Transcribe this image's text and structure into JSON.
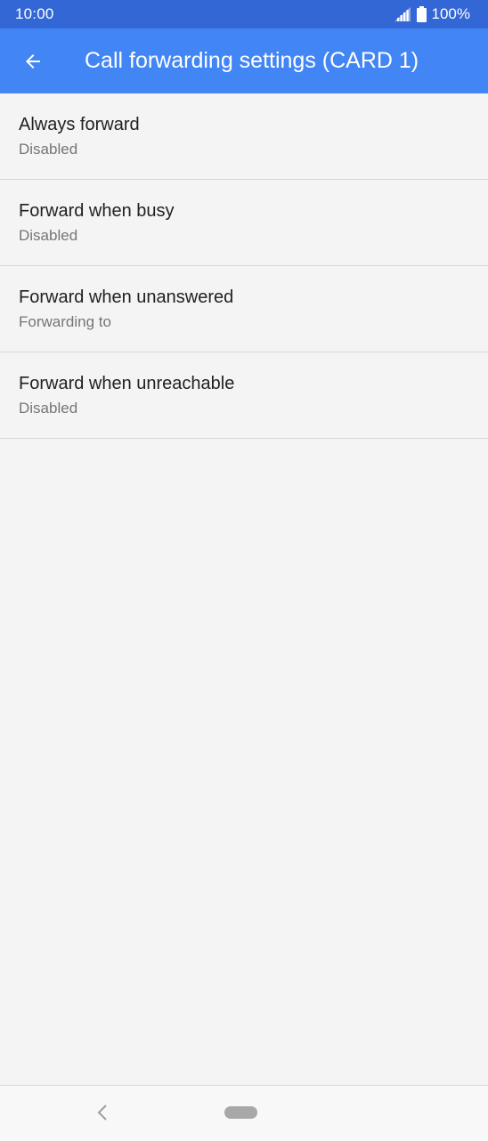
{
  "status_bar": {
    "time": "10:00",
    "battery": "100%",
    "icons": [
      "signal-icon",
      "battery-icon"
    ]
  },
  "app_bar": {
    "title": "Call forwarding settings (CARD 1)",
    "back_icon": "arrow-back-icon",
    "color": "#4285f4"
  },
  "items": [
    {
      "title": "Always forward",
      "subtitle": "Disabled"
    },
    {
      "title": "Forward when busy",
      "subtitle": "Disabled"
    },
    {
      "title": "Forward when unanswered",
      "subtitle": "Forwarding to"
    },
    {
      "title": "Forward when unreachable",
      "subtitle": "Disabled"
    }
  ],
  "nav_bar": {
    "icons": [
      "nav-back-icon",
      "home-pill-icon"
    ]
  }
}
